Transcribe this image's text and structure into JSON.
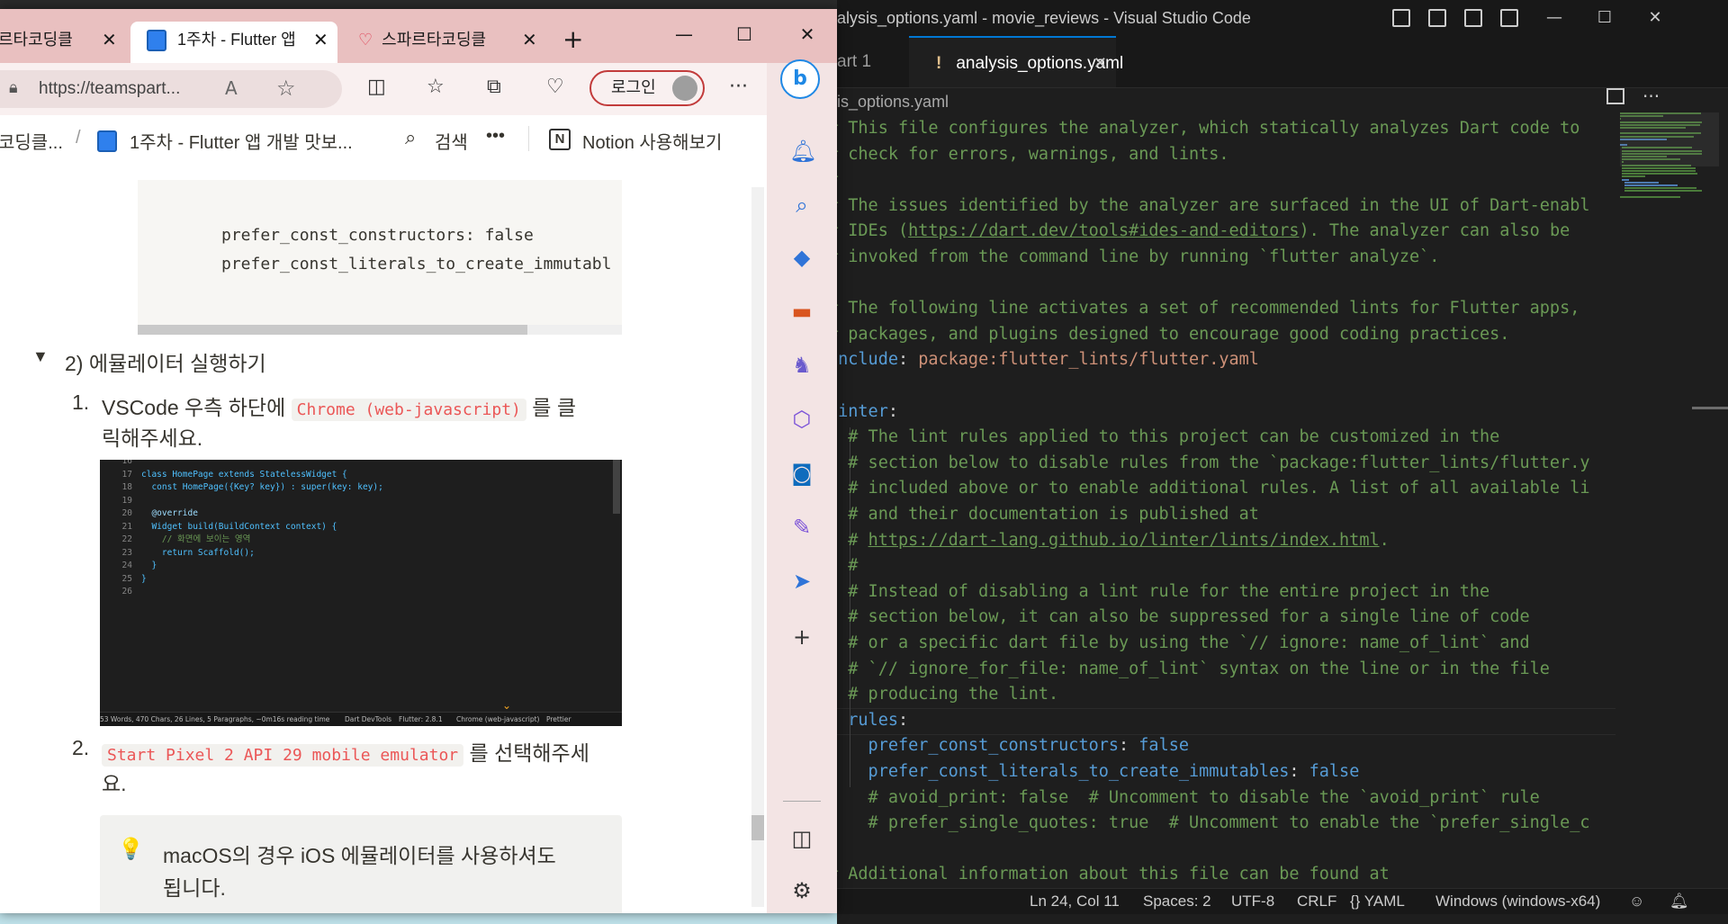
{
  "vscode": {
    "title": "alysis_options.yaml - movie_reviews - Visual Studio Code",
    "tabs": {
      "partial_label": "art 1",
      "active_mark": "!",
      "active_label": "analysis_options.yaml"
    },
    "breadcrumb": "is_options.yaml",
    "code_lines": [
      "# This file configures the analyzer, which statically analyzes Dart code to",
      "# check for errors, warnings, and lints.",
      "#",
      "# The issues identified by the analyzer are surfaced in the UI of Dart-enabl",
      "# IDEs (https://dart.dev/tools#ides-and-editors). The analyzer can also be",
      "# invoked from the command line by running `flutter analyze`.",
      "",
      "# The following line activates a set of recommended lints for Flutter apps,",
      "# packages, and plugins designed to encourage good coding practices.",
      "include: package:flutter_lints/flutter.yaml",
      "",
      "linter:",
      "  # The lint rules applied to this project can be customized in the",
      "  # section below to disable rules from the `package:flutter_lints/flutter.y",
      "  # included above or to enable additional rules. A list of all available li",
      "  # and their documentation is published at",
      "  # https://dart-lang.github.io/linter/lints/index.html.",
      "  #",
      "  # Instead of disabling a lint rule for the entire project in the",
      "  # section below, it can also be suppressed for a single line of code",
      "  # or a specific dart file by using the `// ignore: name_of_lint` and",
      "  # `// ignore_for_file: name_of_lint` syntax on the line or in the file",
      "  # producing the lint.",
      "  rules:",
      "    prefer_const_constructors: false",
      "    prefer_const_literals_to_create_immutables: false",
      "    # avoid_print: false  # Uncomment to disable the `avoid_print` rule",
      "    # prefer_single_quotes: true  # Uncomment to enable the `prefer_single_c",
      "",
      "# Additional information about this file can be found at"
    ],
    "status": {
      "position": "Ln 24, Col 11",
      "spaces": "Spaces: 2",
      "encoding": "UTF-8",
      "eol": "CRLF",
      "language": "{} YAML",
      "platform": "Windows (windows-x64)"
    },
    "colors": {
      "comment": "#6a9955",
      "key": "#569cd6",
      "string": "#ce9178",
      "background": "#1e1e1e"
    }
  },
  "edge": {
    "tabs": [
      {
        "label": "르타코딩클",
        "favicon": "notion"
      },
      {
        "label": "1주차 - Flutter 앱",
        "favicon": "notion",
        "active": true
      },
      {
        "label": "스파르타코딩클",
        "favicon": "heart"
      }
    ],
    "new_tab": "+",
    "address": "https://teamspart...",
    "login_label": "로그인",
    "notion_bar": {
      "crumb_parent": "코딩클...",
      "separator": "/",
      "crumb_page": "1주차 - Flutter 앱 개발 맛보...",
      "search_label": "검색",
      "more": "•••",
      "notion_cta": "Notion 사용해보기"
    },
    "code_block_lines": [
      "prefer_const_constructors: false",
      "prefer_const_literals_to_create_immutabl"
    ],
    "toggle_heading": "2) 에뮬레이터 실행하기",
    "step1": {
      "num": "1.",
      "text_before": "VSCode 우측 하단에",
      "code": "Chrome (web-javascript)",
      "text_after": "를 클",
      "text_line2": "릭해주세요."
    },
    "step2": {
      "num": "2.",
      "code": "Start Pixel 2 API 29 mobile emulator",
      "text_after": "를 선택해주세",
      "text_line2": "요."
    },
    "callout": {
      "icon": "💡",
      "line1": "macOS의 경우 iOS 에뮬레이터를 사용하셔도",
      "line2": "됩니다."
    },
    "embedded_screenshot": {
      "code_lines": [
        {
          "n": "16",
          "t": ""
        },
        {
          "n": "17",
          "t": "class HomePage extends StatelessWidget {"
        },
        {
          "n": "18",
          "t": "  const HomePage({Key? key}) : super(key: key);"
        },
        {
          "n": "19",
          "t": ""
        },
        {
          "n": "20",
          "t": "  @override"
        },
        {
          "n": "21",
          "t": "  Widget build(BuildContext context) {"
        },
        {
          "n": "22",
          "t": "    // 화면에 보이는 영역"
        },
        {
          "n": "23",
          "t": "    return Scaffold();"
        },
        {
          "n": "24",
          "t": "  }"
        },
        {
          "n": "25",
          "t": "}"
        },
        {
          "n": "26",
          "t": ""
        }
      ],
      "status_left": "53 Words, 470 Chars, 26 Lines, 5 Paragraphs, ~0m16s reading time",
      "status_devtools": "Dart DevTools",
      "status_flutter": "Flutter: 2.8.1",
      "status_chrome": "Chrome (web-javascript)",
      "status_prettier": "Prettier"
    }
  }
}
